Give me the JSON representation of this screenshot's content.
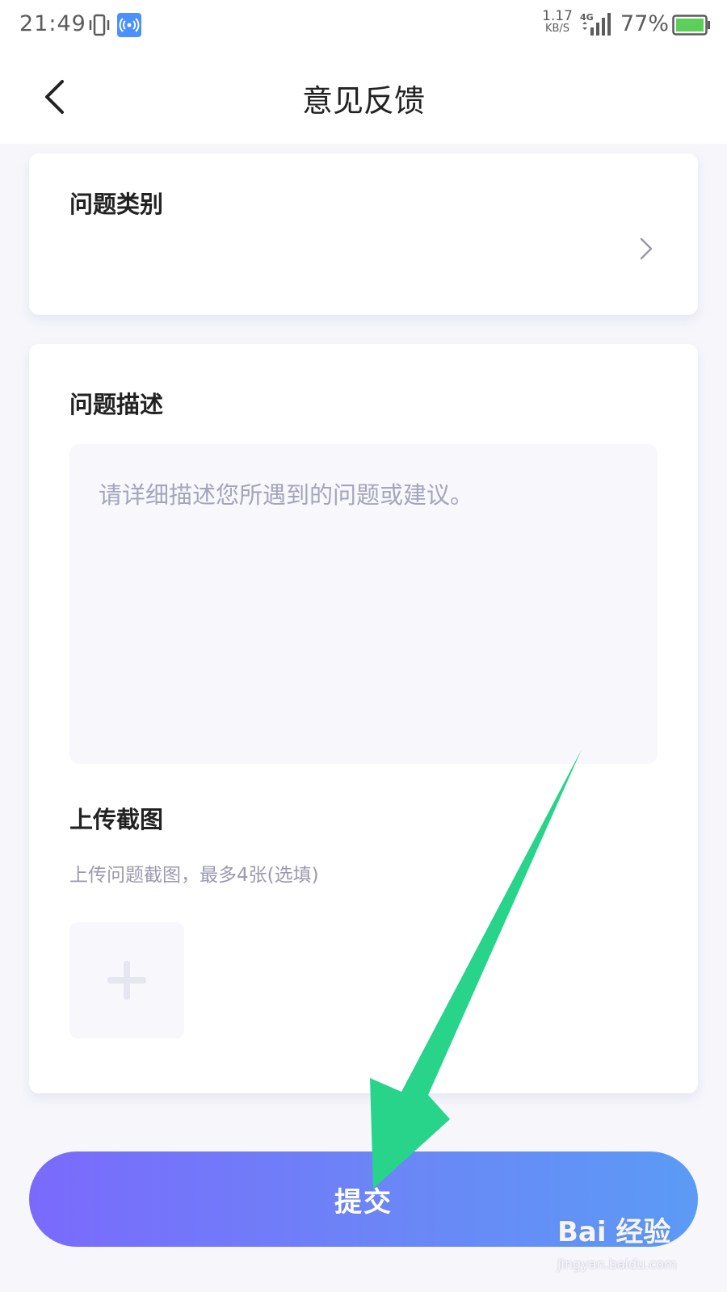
{
  "status_bar": {
    "time": "21:49",
    "net_speed_value": "1.17",
    "net_speed_unit": "KB/S",
    "network_type": "4G",
    "battery_percent": "77%",
    "icons": [
      "vibrate-icon",
      "hotspot-icon",
      "signal-icon",
      "battery-icon"
    ]
  },
  "header": {
    "title": "意见反馈",
    "back_icon": "chevron-left-icon"
  },
  "category_card": {
    "title": "问题类别",
    "value": ""
  },
  "description_card": {
    "title": "问题描述",
    "placeholder": "请详细描述您所遇到的问题或建议。",
    "upload_title": "上传截图",
    "upload_hint": "上传问题截图，最多4张(选填)",
    "upload_icon": "plus-icon"
  },
  "submit": {
    "label": "提交"
  },
  "watermark": {
    "logo": "Bai 经验",
    "url": "jingyan.baidu.com"
  },
  "colors": {
    "accent_gradient_start": "#7a6afc",
    "accent_gradient_end": "#5b9bf6",
    "annotation_arrow": "#27d48a",
    "page_background": "#f6f6fb"
  }
}
